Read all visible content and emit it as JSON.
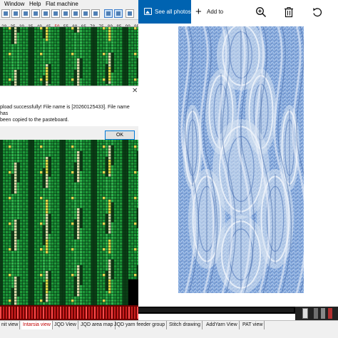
{
  "app": {
    "menu": [
      "Window",
      "Help",
      "Flat machine"
    ],
    "ruler_ticks": [
      "20",
      "25",
      "30",
      "35",
      "40",
      "45",
      "50",
      "55",
      "60",
      "65",
      "70",
      "75",
      "80",
      "85",
      "90",
      "95",
      "100"
    ]
  },
  "dialog": {
    "message_line1": "pload successfully! File name is [20260125433]. File name has",
    "message_line2": "been copied to the pasteboard.",
    "ok_label": "OK"
  },
  "tabs": [
    {
      "label": "nit view",
      "active": false
    },
    {
      "label": "Intarsia view",
      "active": true
    },
    {
      "label": "JQD View",
      "active": false
    },
    {
      "label": "JQD area map",
      "active": false
    },
    {
      "label": "JQD yarn feeder group",
      "active": false
    },
    {
      "label": "Stitch drawing",
      "active": false
    },
    {
      "label": "AddYarn View",
      "active": false
    },
    {
      "label": "PAT view",
      "active": false
    }
  ],
  "photos": {
    "see_all_label": "See all photos",
    "add_to_label": "Add to",
    "icons": [
      "photos-icon",
      "plus-icon",
      "zoom-in-icon",
      "delete-icon",
      "rotate-icon"
    ],
    "accent_color": "#0063b1"
  }
}
